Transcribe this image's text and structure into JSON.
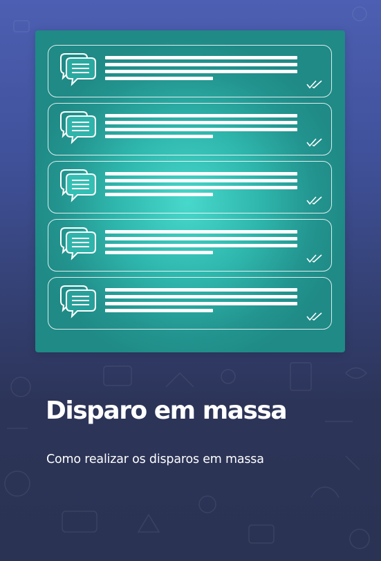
{
  "accent_color": "#2fb7ad",
  "background_color": "#2b3354",
  "card": {
    "messages": [
      {
        "icon": "chat-bubbles-icon",
        "status_icon": "double-check-icon"
      },
      {
        "icon": "chat-bubbles-icon",
        "status_icon": "double-check-icon"
      },
      {
        "icon": "chat-bubbles-icon",
        "status_icon": "double-check-icon"
      },
      {
        "icon": "chat-bubbles-icon",
        "status_icon": "double-check-icon"
      },
      {
        "icon": "chat-bubbles-icon",
        "status_icon": "double-check-icon"
      }
    ]
  },
  "title": "Disparo em massa",
  "subtitle": "Como realizar os disparos em massa"
}
